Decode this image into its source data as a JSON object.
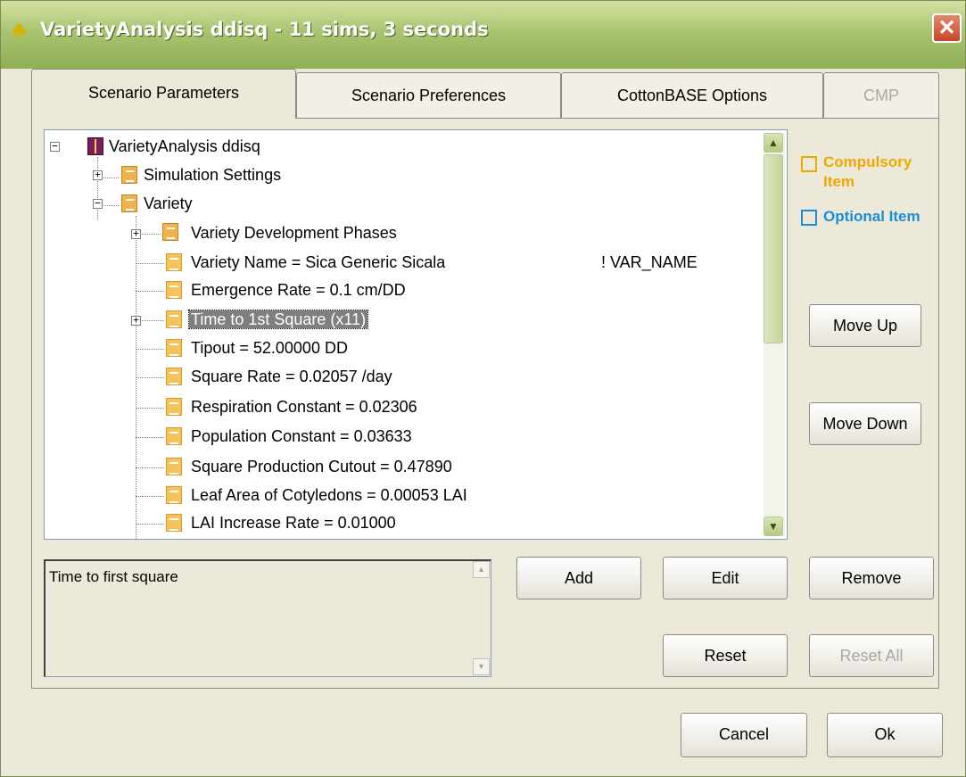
{
  "window": {
    "title": "VarietyAnalysis ddisq - 11 sims, 3 seconds",
    "close_glyph": "✕"
  },
  "tabs": [
    {
      "label": "Scenario Parameters",
      "active": true
    },
    {
      "label": "Scenario Preferences",
      "active": false
    },
    {
      "label": "CottonBASE Options",
      "active": false
    },
    {
      "label": "CMP",
      "active": false,
      "disabled": true
    }
  ],
  "tree": {
    "root": "VarietyAnalysis ddisq",
    "simulation_settings": "Simulation Settings",
    "variety": "Variety",
    "items": [
      {
        "label": "Variety Development Phases",
        "icon": "folder-icon",
        "expandable": true
      },
      {
        "label": "Variety Name = Sica  Generic Sicala",
        "extra": "! VAR_NAME",
        "icon": "doc-icon"
      },
      {
        "label": "Emergence Rate = 0.1  cm/DD",
        "icon": "doc-icon"
      },
      {
        "label": "Time to 1st Square (x11)",
        "icon": "doc-icon",
        "expandable": true,
        "selected": true
      },
      {
        "label": "Tipout = 52.00000  DD",
        "icon": "doc-icon"
      },
      {
        "label": "Square Rate = 0.02057  /day",
        "icon": "doc-icon"
      },
      {
        "label": "Respiration Constant = 0.02306",
        "icon": "doc-icon"
      },
      {
        "label": "Population Constant = 0.03633",
        "icon": "doc-icon"
      },
      {
        "label": "Square Production Cutout = 0.47890",
        "icon": "doc-icon"
      },
      {
        "label": "Leaf Area of Cotyledons = 0.00053  LAI",
        "icon": "doc-icon"
      },
      {
        "label": "LAI Increase Rate = 0.01000",
        "icon": "doc-icon"
      }
    ]
  },
  "legend": {
    "compulsory": "Compulsory Item",
    "compulsory_color": "#f0a800",
    "optional": "Optional Item",
    "optional_color": "#1a8fd8"
  },
  "buttons": {
    "move_up": "Move Up",
    "move_down": "Move Down",
    "add": "Add",
    "edit": "Edit",
    "remove": "Remove",
    "reset": "Reset",
    "reset_all": "Reset All",
    "cancel": "Cancel",
    "ok": "Ok"
  },
  "description": "Time to first square"
}
